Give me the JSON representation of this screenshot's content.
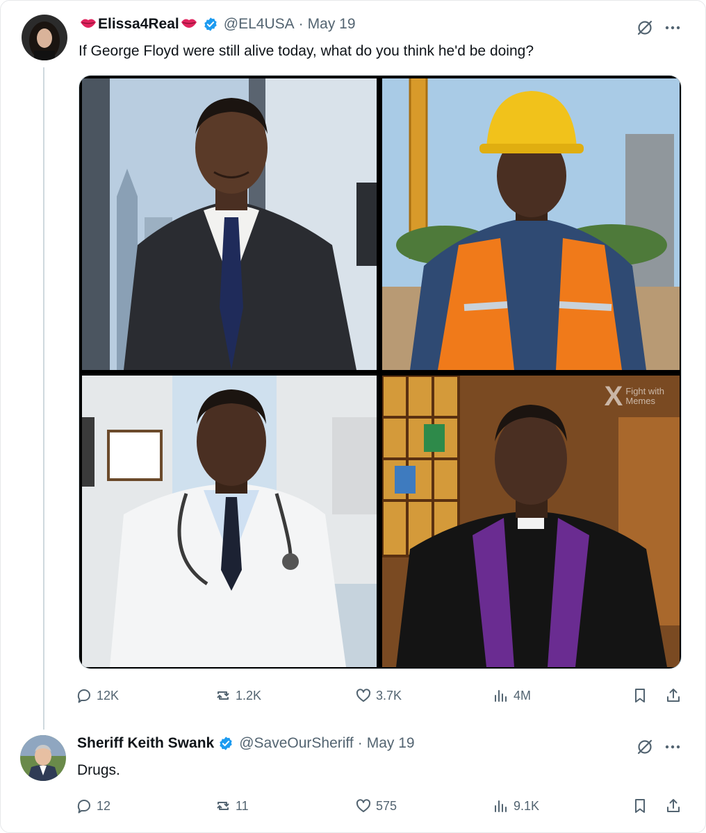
{
  "tweet": {
    "display_name": "Elissa4Real",
    "handle": "@EL4USA",
    "date": "May 19",
    "text": "If George Floyd were still alive today, what do you think he'd be doing?",
    "watermark_line1": "Fight with",
    "watermark_line2": "Memes",
    "stats": {
      "replies": "12K",
      "reposts": "1.2K",
      "likes": "3.7K",
      "views": "4M"
    }
  },
  "reply": {
    "display_name": "Sheriff Keith Swank",
    "handle": "@SaveOurSheriff",
    "date": "May 19",
    "text": "Drugs.",
    "stats": {
      "replies": "12",
      "reposts": "11",
      "likes": "575",
      "views": "9.1K"
    }
  },
  "separator": "·",
  "colors": {
    "verified": "#1d9bf0",
    "muted": "#536471",
    "lips": "#e0245e",
    "robe_stole": "#6a2c91"
  }
}
